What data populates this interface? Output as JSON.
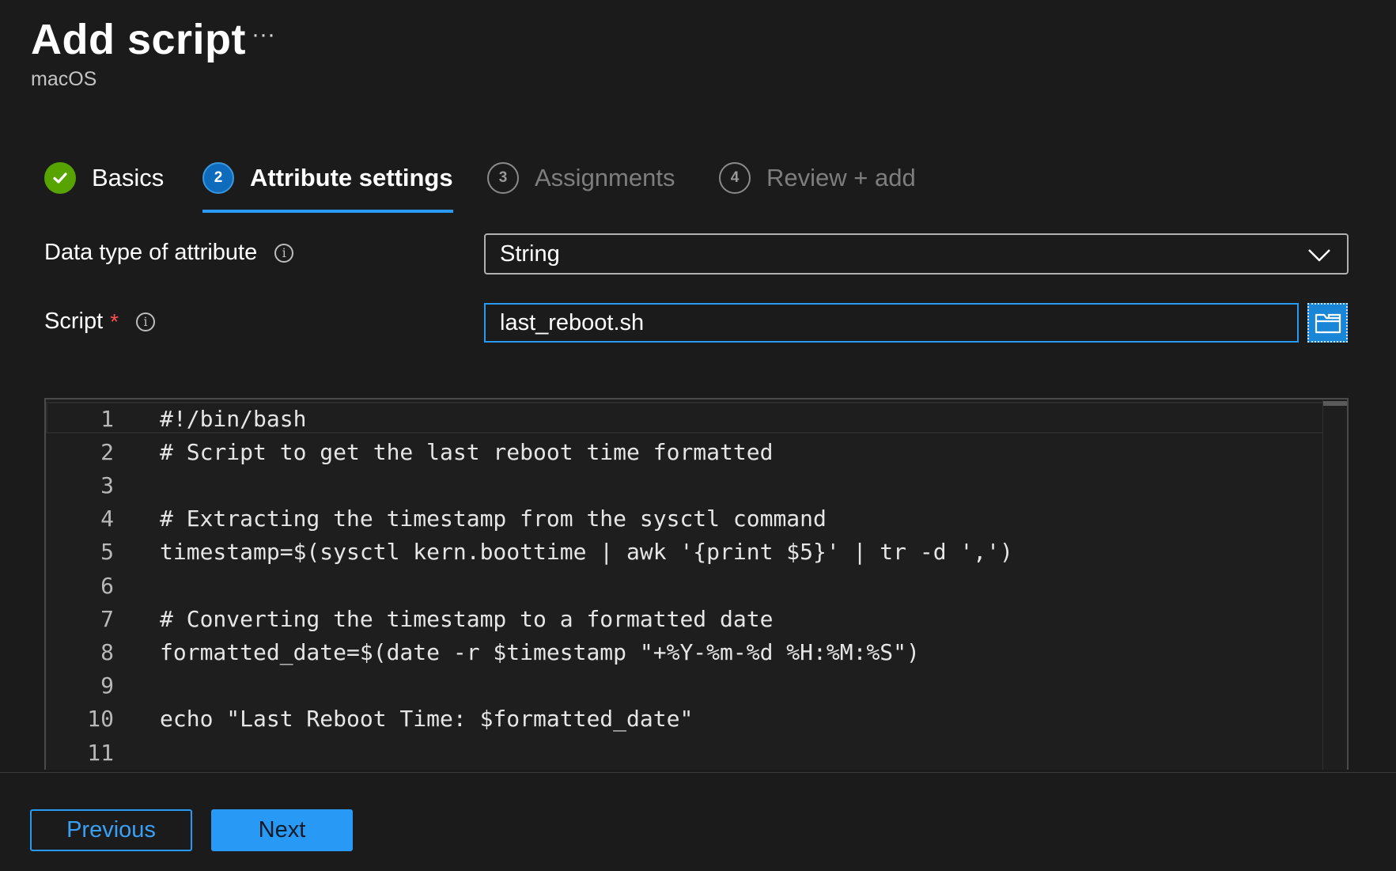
{
  "header": {
    "title": "Add script",
    "more_label": "···",
    "subtitle": "macOS"
  },
  "steps": [
    {
      "number": "",
      "label": "Basics",
      "state": "done"
    },
    {
      "number": "2",
      "label": "Attribute settings",
      "state": "active"
    },
    {
      "number": "3",
      "label": "Assignments",
      "state": "pending"
    },
    {
      "number": "4",
      "label": "Review + add",
      "state": "pending"
    }
  ],
  "form": {
    "data_type": {
      "label": "Data type of attribute",
      "info_label": "i",
      "value": "String"
    },
    "script": {
      "label": "Script",
      "required_mark": "*",
      "info_label": "i",
      "value": "last_reboot.sh"
    }
  },
  "code": {
    "lines": [
      {
        "number": "1",
        "text": "#!/bin/bash"
      },
      {
        "number": "2",
        "text": "# Script to get the last reboot time formatted"
      },
      {
        "number": "3",
        "text": ""
      },
      {
        "number": "4",
        "text": "# Extracting the timestamp from the sysctl command"
      },
      {
        "number": "5",
        "text": "timestamp=$(sysctl kern.boottime | awk '{print $5}' | tr -d ',')"
      },
      {
        "number": "6",
        "text": ""
      },
      {
        "number": "7",
        "text": "# Converting the timestamp to a formatted date"
      },
      {
        "number": "8",
        "text": "formatted_date=$(date -r $timestamp \"+%Y-%m-%d %H:%M:%S\")"
      },
      {
        "number": "9",
        "text": ""
      },
      {
        "number": "10",
        "text": "echo \"Last Reboot Time: $formatted_date\""
      },
      {
        "number": "11",
        "text": ""
      }
    ]
  },
  "footer": {
    "previous_label": "Previous",
    "next_label": "Next"
  },
  "colors": {
    "background": "#1b1b1b",
    "accent": "#2899f5",
    "success": "#57a300",
    "required": "#ff4d4d"
  }
}
